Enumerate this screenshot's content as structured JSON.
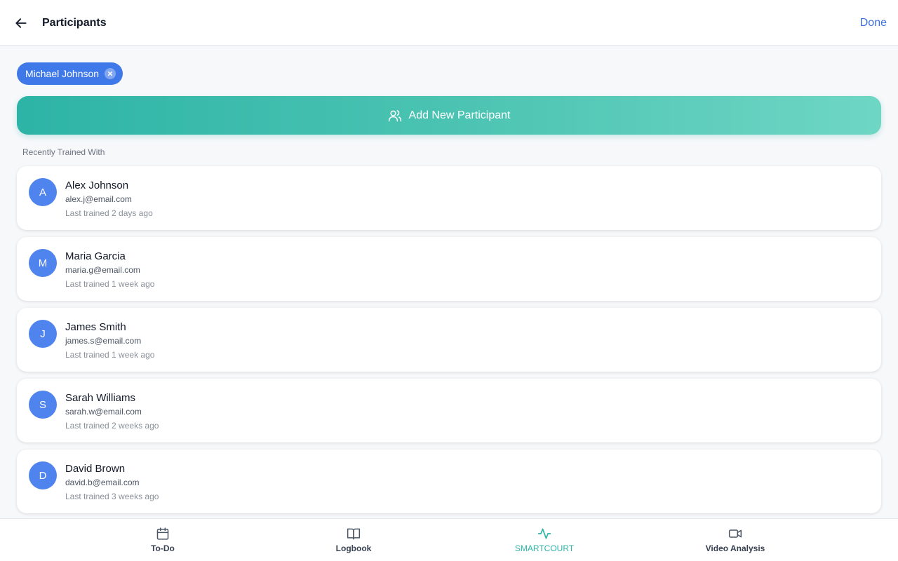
{
  "header": {
    "title": "Participants",
    "done_label": "Done"
  },
  "selected": [
    {
      "name": "Michael Johnson"
    }
  ],
  "add_button": {
    "label": "Add New Participant",
    "icon": "users-icon"
  },
  "recent": {
    "label": "Recently Trained With",
    "participants": [
      {
        "initial": "A",
        "name": "Alex Johnson",
        "email": "alex.j@email.com",
        "last": "Last trained 2 days ago"
      },
      {
        "initial": "M",
        "name": "Maria Garcia",
        "email": "maria.g@email.com",
        "last": "Last trained 1 week ago"
      },
      {
        "initial": "J",
        "name": "James Smith",
        "email": "james.s@email.com",
        "last": "Last trained 1 week ago"
      },
      {
        "initial": "S",
        "name": "Sarah Williams",
        "email": "sarah.w@email.com",
        "last": "Last trained 2 weeks ago"
      },
      {
        "initial": "D",
        "name": "David Brown",
        "email": "david.b@email.com",
        "last": "Last trained 3 weeks ago"
      }
    ]
  },
  "bottom_nav": {
    "items": [
      {
        "label": "To-Do",
        "icon": "calendar-icon"
      },
      {
        "label": "Logbook",
        "icon": "book-icon"
      },
      {
        "label": "SMARTCOURT",
        "icon": "activity-icon",
        "active": true
      },
      {
        "label": "Video Analysis",
        "icon": "video-icon"
      }
    ]
  },
  "colors": {
    "primary": "#3f78e8",
    "accent": "#2db4a6",
    "avatar": "#4f84ef"
  }
}
